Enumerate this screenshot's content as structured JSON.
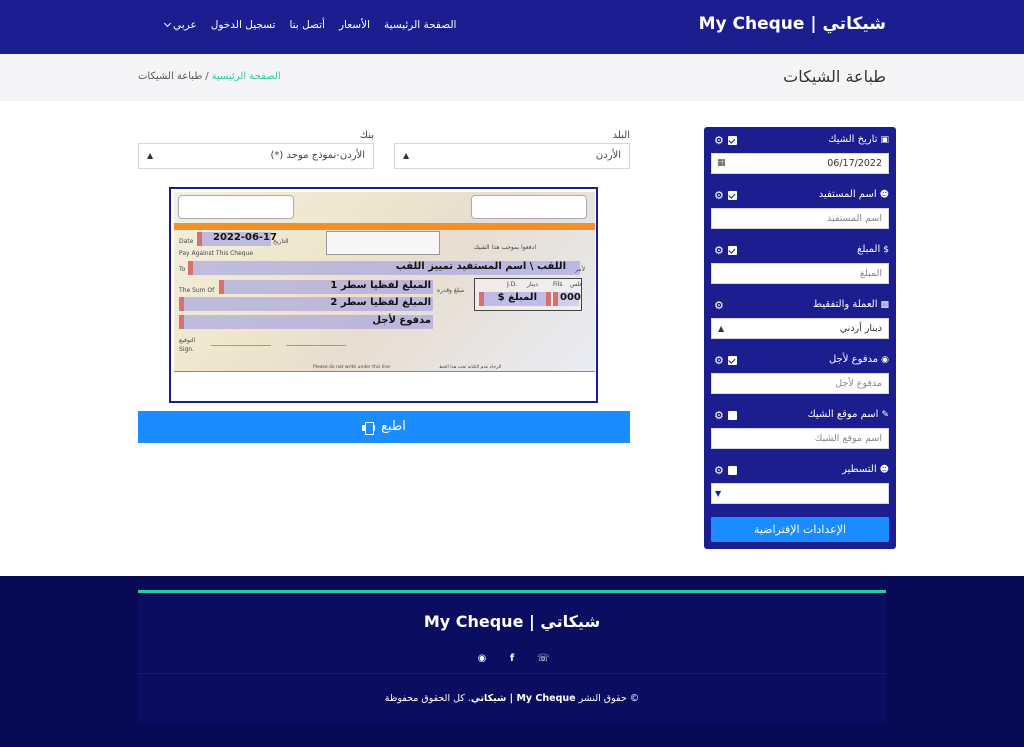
{
  "header": {
    "brand": "My Cheque | شيكاتي",
    "nav": [
      "الصفحة الرئيسية",
      "الأسعار",
      "أتصل بنا",
      "تسجيل الدخول"
    ],
    "language": "عربي"
  },
  "titlebar": {
    "title": "طباعة الشيكات",
    "breadcrumb_home": "الصفحة الرئيسية",
    "breadcrumb_sep": "/",
    "breadcrumb_current": "طباعة الشيكات"
  },
  "selectors": {
    "country_label": "البلد",
    "country_value": "الأردن",
    "bank_label": "بنك",
    "bank_value": "الأردن-نموذج موحد (*)"
  },
  "settings": {
    "fields": [
      {
        "label": "تاريخ الشيك",
        "value": "06/17/2022",
        "placeholder": "",
        "checked": true,
        "icon": "calendar-icon"
      },
      {
        "label": "اسم المستفيد",
        "value": "",
        "placeholder": "اسم المستفيد",
        "checked": true,
        "icon": "user-icon"
      },
      {
        "label": "المبلغ",
        "value": "",
        "placeholder": "المبلغ",
        "checked": true,
        "icon": "dollar-icon"
      },
      {
        "label": "العملة والتفقيط",
        "value": "دينار أردني",
        "placeholder": "",
        "checked": null,
        "icon": "money-icon"
      },
      {
        "label": "مدفوع لأجل",
        "value": "",
        "placeholder": "مدفوع لأجل",
        "checked": true,
        "icon": "eye-slash-icon"
      },
      {
        "label": "اسم موقع الشيك",
        "value": "",
        "placeholder": "اسم موقع الشيك",
        "checked": false,
        "icon": "signature-icon"
      },
      {
        "label": "التسطير",
        "value": "",
        "placeholder": "",
        "checked": false,
        "icon": "user-icon"
      }
    ],
    "reset_label": "الإعدادات الإفتراضية"
  },
  "cheque": {
    "date_label_en": "Date",
    "date_label_ar": "التاريخ",
    "date_value": "2022-06-17",
    "pay_against": "Pay Against This Cheque",
    "to_label": "To",
    "to_label_ar": "لأمر",
    "pay_ar": "ادفعوا بموجب هذا الشيك",
    "payee_text": "اللقب \\ اسم المستفيد تمييز اللقب",
    "sum_label": "The Sum Of",
    "sum_label_ar": "مبلغ وقدره",
    "amount_words_1": "المبلغ لفظيا سطر 1",
    "amount_words_2": "المبلغ لفظيا سطر 2",
    "paid_for": "مدفوع لأجل",
    "jd_label": "J.D.",
    "fils_label": "Fils",
    "dinar_ar": "دينار",
    "fils_ar": "فلس",
    "amount_number": "المبلغ $",
    "fils_value": "000",
    "sign_ar": "التوقيع",
    "sign_en": "Sign.",
    "nowrite_en": "Please do not write under this line",
    "nowrite_ar": "الرجاء عدم الكتابة تحت هذا الخط"
  },
  "print_label": "اطبع",
  "footer": {
    "brand": "My Cheque | شيكاتي",
    "copyright_prefix": "© حقوق النشر",
    "copyright_brand": "My Cheque | شيكاتي",
    "copyright_suffix": ". كل الحقوق محفوظة"
  },
  "colors": {
    "primary": "#1c1d8f",
    "accent": "#1a8cff",
    "footer": "#080a56",
    "green": "#2ecc9a"
  }
}
